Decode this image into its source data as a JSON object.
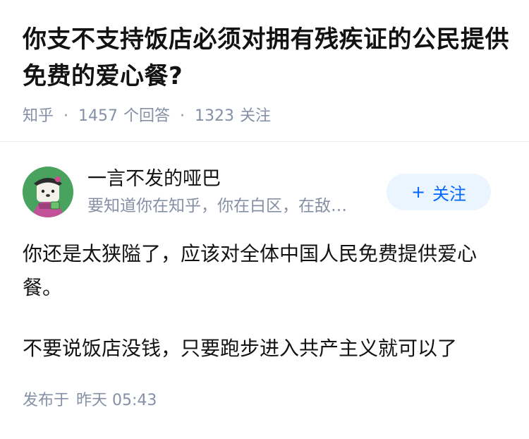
{
  "question": {
    "title": "你支不支持饭店必须对拥有残疾证的公民提供免费的爱心餐?",
    "source": "知乎",
    "answer_count": "1457",
    "answer_label": "个回答",
    "follow_count": "1323",
    "follow_label": "关注"
  },
  "author": {
    "name": "一言不发的哑巴",
    "bio": "要知道你在知乎，你在白区，在敌…",
    "avatar_icon": "cartoon-character-avatar",
    "follow_button": {
      "plus": "+",
      "label": "关注"
    }
  },
  "answer": {
    "paragraphs": [
      "你还是太狭隘了，应该对全体中国人民免费提供爱心餐。",
      "不要说饭店没钱，只要跑步进入共产主义就可以了"
    ],
    "published_label": "发布于",
    "published_time": "昨天 05:43"
  },
  "colors": {
    "meta_gray": "#8590a6",
    "text": "#121212",
    "accent_blue": "#0066ff",
    "follow_bg": "#ebf5ff",
    "avatar_green": "#49a35f"
  }
}
